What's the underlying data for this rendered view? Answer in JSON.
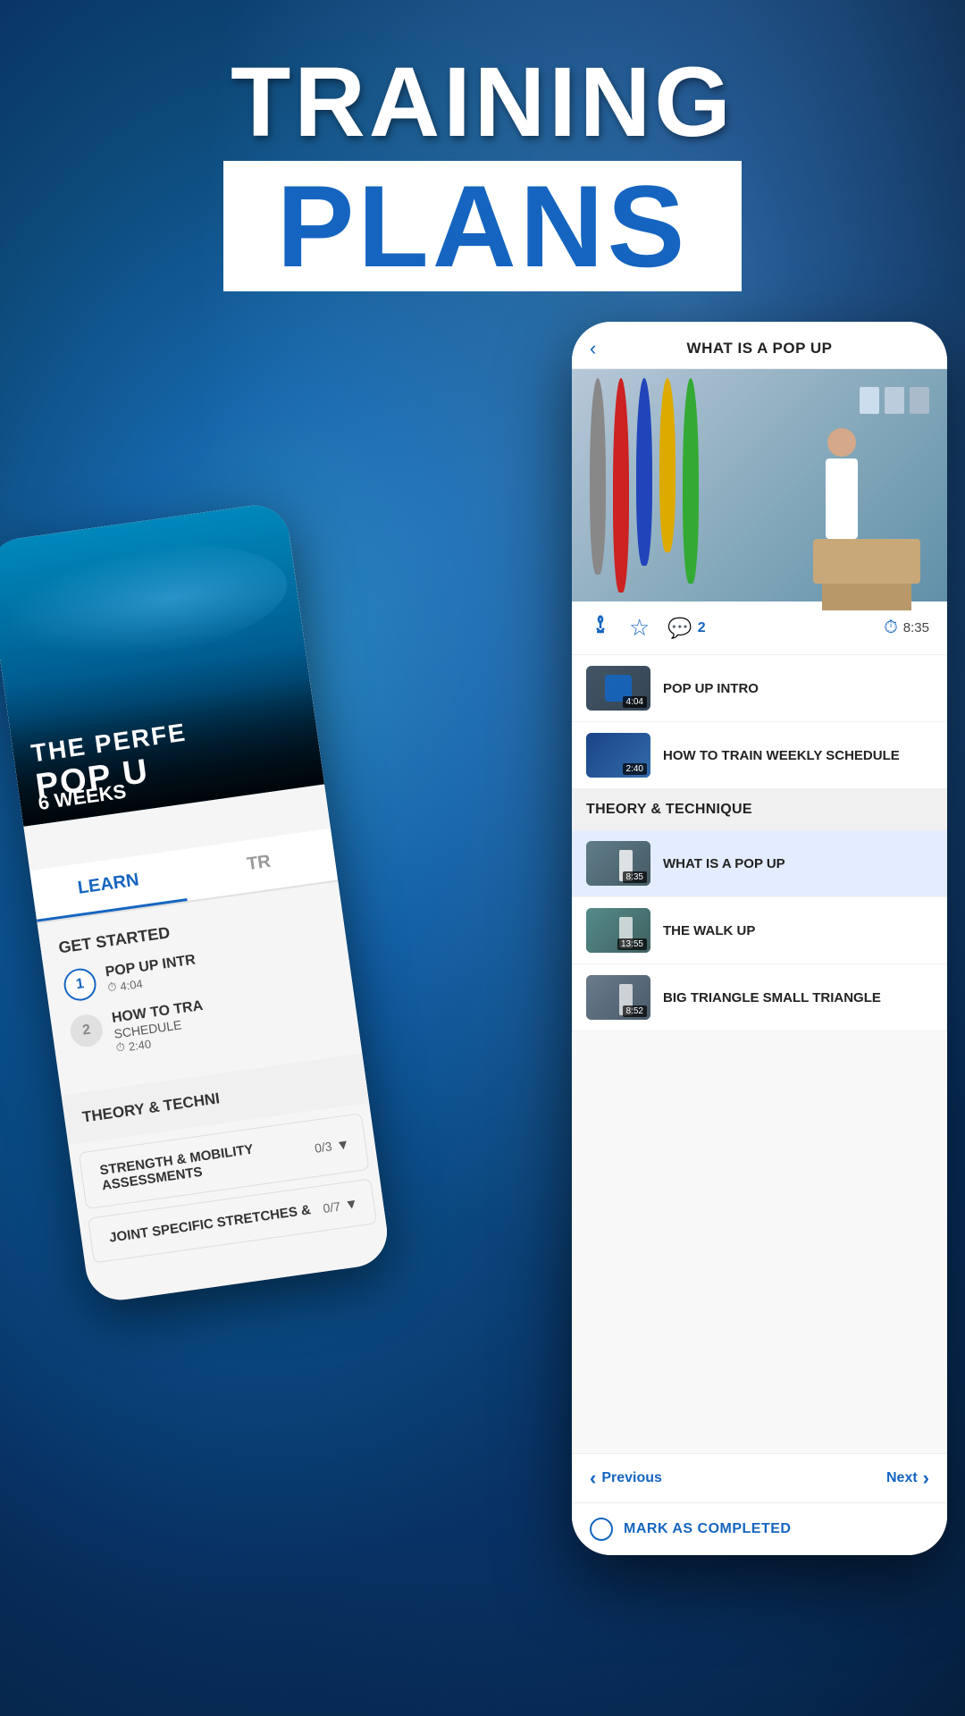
{
  "page": {
    "background_color": "#1a5a8a"
  },
  "header": {
    "line1": "TRAINING",
    "line2": "PLANS"
  },
  "left_phone": {
    "hero": {
      "line1": "THE PERFE",
      "line2": "POP U",
      "weeks": "6 WEEKS"
    },
    "tabs": [
      {
        "label": "LEARN",
        "active": true
      },
      {
        "label": "TR",
        "active": false
      }
    ],
    "get_started": {
      "title": "GET STARTED",
      "items": [
        {
          "number": "1",
          "title": "POP UP INTR",
          "time": "4:04",
          "active": true
        },
        {
          "number": "2",
          "title": "HOW TO TRA",
          "subtitle": "SCHEDULE",
          "time": "2:40",
          "active": false
        }
      ]
    },
    "sections": [
      {
        "title": "THEORY & TECHNI",
        "count": null
      },
      {
        "title": "STRENGTH & MOBILITY ASSESSMENTS",
        "count": "0/3"
      },
      {
        "title": "JOINT SPECIFIC STRETCHES &",
        "count": "0/7"
      }
    ]
  },
  "right_phone": {
    "header": {
      "back_icon": "‹",
      "title": "WHAT IS A POP UP"
    },
    "action_bar": {
      "download_icon": "↓",
      "star_icon": "☆",
      "comment_icon": "💬",
      "comment_count": "2",
      "clock_icon": "⏱",
      "duration": "8:35"
    },
    "video_list": [
      {
        "id": "popup-intro",
        "title": "POP UP INTRO",
        "time": "4:04",
        "active": false
      },
      {
        "id": "how-to-train",
        "title": "HOW TO TRAIN WEEKLY SCHEDULE",
        "time": "2:40",
        "active": false
      }
    ],
    "theory_section": {
      "title": "THEORY & TECHNIQUE"
    },
    "theory_videos": [
      {
        "id": "what-is-popup",
        "title": "WHAT IS A POP UP",
        "time": "8:35",
        "active": true
      },
      {
        "id": "the-walk-up",
        "title": "THE WALK UP",
        "time": "13:55",
        "active": false
      },
      {
        "id": "big-triangle",
        "title": "BIG TRIANGLE SMALL TRIANGLE",
        "time": "8:52",
        "active": false
      }
    ],
    "navigation": {
      "prev_label": "Previous",
      "next_label": "Next",
      "prev_icon": "‹",
      "next_icon": "›"
    },
    "mark_completed": {
      "label": "MARK AS COMPLETED"
    }
  }
}
